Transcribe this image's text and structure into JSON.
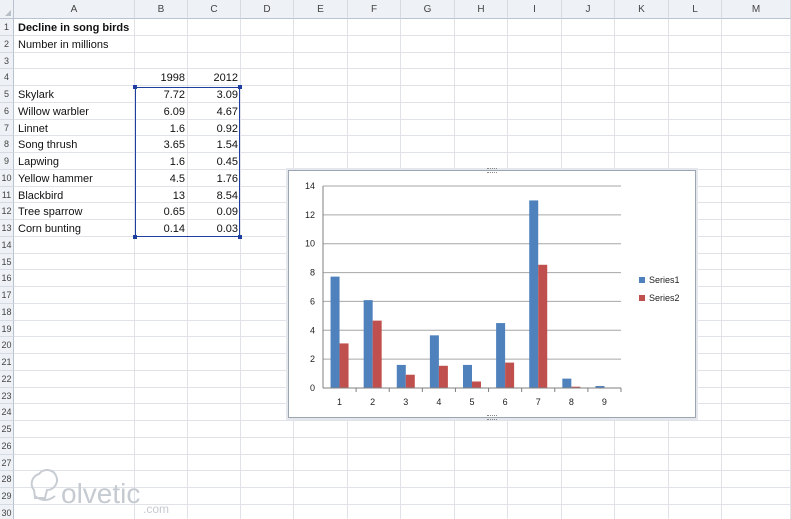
{
  "columns": [
    "A",
    "B",
    "C",
    "D",
    "E",
    "F",
    "G",
    "H",
    "I",
    "J",
    "K",
    "L",
    "M"
  ],
  "rows": [
    "1",
    "2",
    "3",
    "4",
    "5",
    "6",
    "7",
    "8",
    "9",
    "10",
    "11",
    "12",
    "13",
    "14",
    "15",
    "16",
    "17",
    "18",
    "19",
    "20",
    "21",
    "22",
    "23",
    "24",
    "25",
    "26",
    "27",
    "28",
    "29",
    "30"
  ],
  "sheet": {
    "title": "Decline in song birds",
    "subtitle": "Number in millions",
    "header_years": [
      "1998",
      "2012"
    ],
    "birds": [
      {
        "name": "Skylark",
        "v1998": "7.72",
        "v2012": "3.09"
      },
      {
        "name": "Willow warbler",
        "v1998": "6.09",
        "v2012": "4.67"
      },
      {
        "name": "Linnet",
        "v1998": "1.6",
        "v2012": "0.92"
      },
      {
        "name": "Song thrush",
        "v1998": "3.65",
        "v2012": "1.54"
      },
      {
        "name": "Lapwing",
        "v1998": "1.6",
        "v2012": "0.45"
      },
      {
        "name": "Yellow hammer",
        "v1998": "4.5",
        "v2012": "1.76"
      },
      {
        "name": "Blackbird",
        "v1998": "13",
        "v2012": "8.54"
      },
      {
        "name": "Tree sparrow",
        "v1998": "0.65",
        "v2012": "0.09"
      },
      {
        "name": "Corn bunting",
        "v1998": "0.14",
        "v2012": "0.03"
      }
    ]
  },
  "chart_data": {
    "type": "bar",
    "categories": [
      "1",
      "2",
      "3",
      "4",
      "5",
      "6",
      "7",
      "8",
      "9"
    ],
    "series": [
      {
        "name": "Series1",
        "values": [
          7.72,
          6.09,
          1.6,
          3.65,
          1.6,
          4.5,
          13,
          0.65,
          0.14
        ],
        "color": "#4f81bd"
      },
      {
        "name": "Series2",
        "values": [
          3.09,
          4.67,
          0.92,
          1.54,
          0.45,
          1.76,
          8.54,
          0.09,
          0.03
        ],
        "color": "#c0504d"
      }
    ],
    "ylim": [
      0,
      14
    ],
    "yticks": [
      "0",
      "2",
      "4",
      "6",
      "8",
      "10",
      "12",
      "14"
    ],
    "grid": true,
    "legend": "right",
    "title": "",
    "xlabel": "",
    "ylabel": ""
  },
  "watermark": {
    "brand": "olvetic",
    "tld": ".com"
  }
}
